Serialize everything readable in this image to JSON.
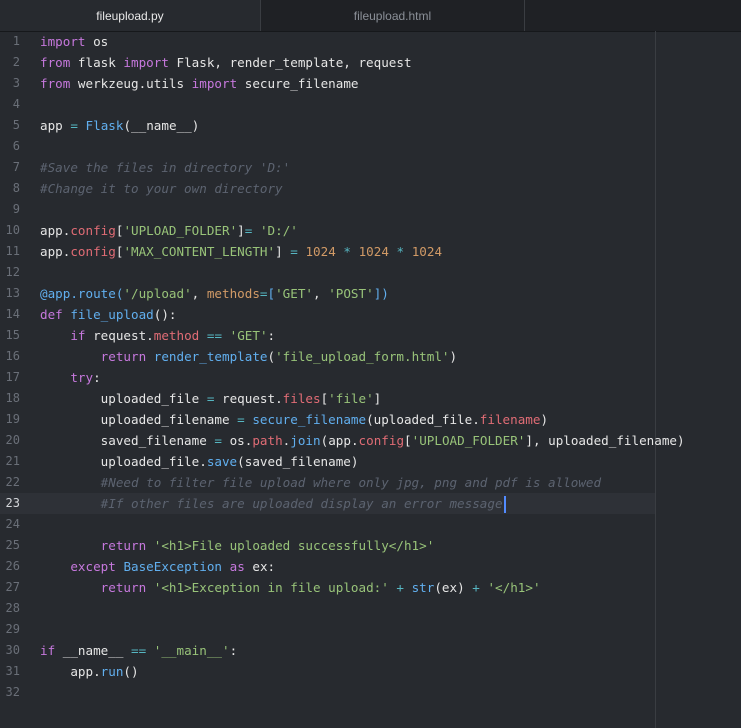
{
  "tabs": [
    {
      "label": "fileupload.py",
      "active": true
    },
    {
      "label": "fileupload.html",
      "active": false
    }
  ],
  "editor": {
    "current_line": 23,
    "lines": [
      {
        "no": "1",
        "tokens": [
          {
            "t": "import",
            "c": "k"
          },
          {
            "t": " os",
            "c": ""
          }
        ]
      },
      {
        "no": "2",
        "tokens": [
          {
            "t": "from",
            "c": "k"
          },
          {
            "t": " flask ",
            "c": ""
          },
          {
            "t": "import",
            "c": "k"
          },
          {
            "t": " Flask, render_template, request",
            "c": ""
          }
        ]
      },
      {
        "no": "3",
        "tokens": [
          {
            "t": "from",
            "c": "k"
          },
          {
            "t": " werkzeug.utils ",
            "c": ""
          },
          {
            "t": "import",
            "c": "k"
          },
          {
            "t": " secure_filename",
            "c": ""
          }
        ]
      },
      {
        "no": "4",
        "tokens": []
      },
      {
        "no": "5",
        "tokens": [
          {
            "t": "app ",
            "c": ""
          },
          {
            "t": "=",
            "c": "o"
          },
          {
            "t": " ",
            "c": ""
          },
          {
            "t": "Flask",
            "c": "f"
          },
          {
            "t": "(__name__)",
            "c": ""
          }
        ]
      },
      {
        "no": "6",
        "tokens": []
      },
      {
        "no": "7",
        "tokens": [
          {
            "t": "#Save the files in directory 'D:'",
            "c": "c"
          }
        ]
      },
      {
        "no": "8",
        "tokens": [
          {
            "t": "#Change it to your own directory",
            "c": "c"
          }
        ]
      },
      {
        "no": "9",
        "tokens": []
      },
      {
        "no": "10",
        "tokens": [
          {
            "t": "app.",
            "c": ""
          },
          {
            "t": "config",
            "c": "p"
          },
          {
            "t": "[",
            "c": ""
          },
          {
            "t": "'UPLOAD_FOLDER'",
            "c": "s"
          },
          {
            "t": "]",
            "c": ""
          },
          {
            "t": "=",
            "c": "o"
          },
          {
            "t": " ",
            "c": ""
          },
          {
            "t": "'D:/'",
            "c": "s"
          }
        ]
      },
      {
        "no": "11",
        "tokens": [
          {
            "t": "app.",
            "c": ""
          },
          {
            "t": "config",
            "c": "p"
          },
          {
            "t": "[",
            "c": ""
          },
          {
            "t": "'MAX_CONTENT_LENGTH'",
            "c": "s"
          },
          {
            "t": "] ",
            "c": ""
          },
          {
            "t": "=",
            "c": "o"
          },
          {
            "t": " ",
            "c": ""
          },
          {
            "t": "1024",
            "c": "n"
          },
          {
            "t": " ",
            "c": ""
          },
          {
            "t": "*",
            "c": "o"
          },
          {
            "t": " ",
            "c": ""
          },
          {
            "t": "1024",
            "c": "n"
          },
          {
            "t": " ",
            "c": ""
          },
          {
            "t": "*",
            "c": "o"
          },
          {
            "t": " ",
            "c": ""
          },
          {
            "t": "1024",
            "c": "n"
          }
        ]
      },
      {
        "no": "12",
        "tokens": []
      },
      {
        "no": "13",
        "tokens": [
          {
            "t": "@app.route(",
            "c": "d"
          },
          {
            "t": "'/upload'",
            "c": "s"
          },
          {
            "t": ", ",
            "c": ""
          },
          {
            "t": "methods",
            "c": "n"
          },
          {
            "t": "=",
            "c": "o"
          },
          {
            "t": "[",
            "c": "d"
          },
          {
            "t": "'GET'",
            "c": "s"
          },
          {
            "t": ", ",
            "c": ""
          },
          {
            "t": "'POST'",
            "c": "s"
          },
          {
            "t": "])",
            "c": "d"
          }
        ]
      },
      {
        "no": "14",
        "tokens": [
          {
            "t": "def",
            "c": "k"
          },
          {
            "t": " ",
            "c": ""
          },
          {
            "t": "file_upload",
            "c": "f"
          },
          {
            "t": "():",
            "c": ""
          }
        ]
      },
      {
        "no": "15",
        "tokens": [
          {
            "t": "    ",
            "c": ""
          },
          {
            "t": "if",
            "c": "k"
          },
          {
            "t": " request.",
            "c": ""
          },
          {
            "t": "method",
            "c": "p"
          },
          {
            "t": " ",
            "c": ""
          },
          {
            "t": "==",
            "c": "o"
          },
          {
            "t": " ",
            "c": ""
          },
          {
            "t": "'GET'",
            "c": "s"
          },
          {
            "t": ":",
            "c": ""
          }
        ]
      },
      {
        "no": "16",
        "tokens": [
          {
            "t": "        ",
            "c": ""
          },
          {
            "t": "return",
            "c": "k"
          },
          {
            "t": " ",
            "c": ""
          },
          {
            "t": "render_template",
            "c": "f"
          },
          {
            "t": "(",
            "c": ""
          },
          {
            "t": "'file_upload_form.html'",
            "c": "s"
          },
          {
            "t": ")",
            "c": ""
          }
        ]
      },
      {
        "no": "17",
        "tokens": [
          {
            "t": "    ",
            "c": ""
          },
          {
            "t": "try",
            "c": "k"
          },
          {
            "t": ":",
            "c": ""
          }
        ]
      },
      {
        "no": "18",
        "tokens": [
          {
            "t": "        uploaded_file ",
            "c": ""
          },
          {
            "t": "=",
            "c": "o"
          },
          {
            "t": " request.",
            "c": ""
          },
          {
            "t": "files",
            "c": "p"
          },
          {
            "t": "[",
            "c": ""
          },
          {
            "t": "'file'",
            "c": "s"
          },
          {
            "t": "]",
            "c": ""
          }
        ]
      },
      {
        "no": "19",
        "tokens": [
          {
            "t": "        uploaded_filename ",
            "c": ""
          },
          {
            "t": "=",
            "c": "o"
          },
          {
            "t": " ",
            "c": ""
          },
          {
            "t": "secure_filename",
            "c": "f"
          },
          {
            "t": "(uploaded_file.",
            "c": ""
          },
          {
            "t": "filename",
            "c": "p"
          },
          {
            "t": ")",
            "c": ""
          }
        ]
      },
      {
        "no": "20",
        "tokens": [
          {
            "t": "        saved_filename ",
            "c": ""
          },
          {
            "t": "=",
            "c": "o"
          },
          {
            "t": " os.",
            "c": ""
          },
          {
            "t": "path",
            "c": "p"
          },
          {
            "t": ".",
            "c": ""
          },
          {
            "t": "join",
            "c": "f"
          },
          {
            "t": "(app.",
            "c": ""
          },
          {
            "t": "config",
            "c": "p"
          },
          {
            "t": "[",
            "c": ""
          },
          {
            "t": "'UPLOAD_FOLDER'",
            "c": "s"
          },
          {
            "t": "], uploaded_filename)",
            "c": ""
          }
        ]
      },
      {
        "no": "21",
        "tokens": [
          {
            "t": "        uploaded_file.",
            "c": ""
          },
          {
            "t": "save",
            "c": "f"
          },
          {
            "t": "(saved_filename)",
            "c": ""
          }
        ]
      },
      {
        "no": "22",
        "tokens": [
          {
            "t": "        ",
            "c": ""
          },
          {
            "t": "#Need to filter file upload where only jpg, png and pdf is allowed",
            "c": "c"
          }
        ]
      },
      {
        "no": "23",
        "tokens": [
          {
            "t": "        ",
            "c": ""
          },
          {
            "t": "#If other files are uploaded display an error message",
            "c": "c"
          }
        ]
      },
      {
        "no": "24",
        "tokens": []
      },
      {
        "no": "25",
        "tokens": [
          {
            "t": "        ",
            "c": ""
          },
          {
            "t": "return",
            "c": "k"
          },
          {
            "t": " ",
            "c": ""
          },
          {
            "t": "'<h1>File uploaded successfully</h1>'",
            "c": "s"
          }
        ]
      },
      {
        "no": "26",
        "tokens": [
          {
            "t": "    ",
            "c": ""
          },
          {
            "t": "except",
            "c": "k"
          },
          {
            "t": " ",
            "c": ""
          },
          {
            "t": "BaseException",
            "c": "f"
          },
          {
            "t": " ",
            "c": ""
          },
          {
            "t": "as",
            "c": "k"
          },
          {
            "t": " ex:",
            "c": ""
          }
        ]
      },
      {
        "no": "27",
        "tokens": [
          {
            "t": "        ",
            "c": ""
          },
          {
            "t": "return",
            "c": "k"
          },
          {
            "t": " ",
            "c": ""
          },
          {
            "t": "'<h1>Exception in file upload:'",
            "c": "s"
          },
          {
            "t": " ",
            "c": ""
          },
          {
            "t": "+",
            "c": "o"
          },
          {
            "t": " ",
            "c": ""
          },
          {
            "t": "str",
            "c": "f"
          },
          {
            "t": "(ex) ",
            "c": ""
          },
          {
            "t": "+",
            "c": "o"
          },
          {
            "t": " ",
            "c": ""
          },
          {
            "t": "'</h1>'",
            "c": "s"
          }
        ]
      },
      {
        "no": "28",
        "tokens": []
      },
      {
        "no": "29",
        "tokens": []
      },
      {
        "no": "30",
        "tokens": [
          {
            "t": "if",
            "c": "k"
          },
          {
            "t": " __name__ ",
            "c": ""
          },
          {
            "t": "==",
            "c": "o"
          },
          {
            "t": " ",
            "c": ""
          },
          {
            "t": "'__main__'",
            "c": "s"
          },
          {
            "t": ":",
            "c": ""
          }
        ]
      },
      {
        "no": "31",
        "tokens": [
          {
            "t": "    app.",
            "c": ""
          },
          {
            "t": "run",
            "c": "f"
          },
          {
            "t": "()",
            "c": ""
          }
        ]
      },
      {
        "no": "32",
        "tokens": []
      }
    ]
  }
}
